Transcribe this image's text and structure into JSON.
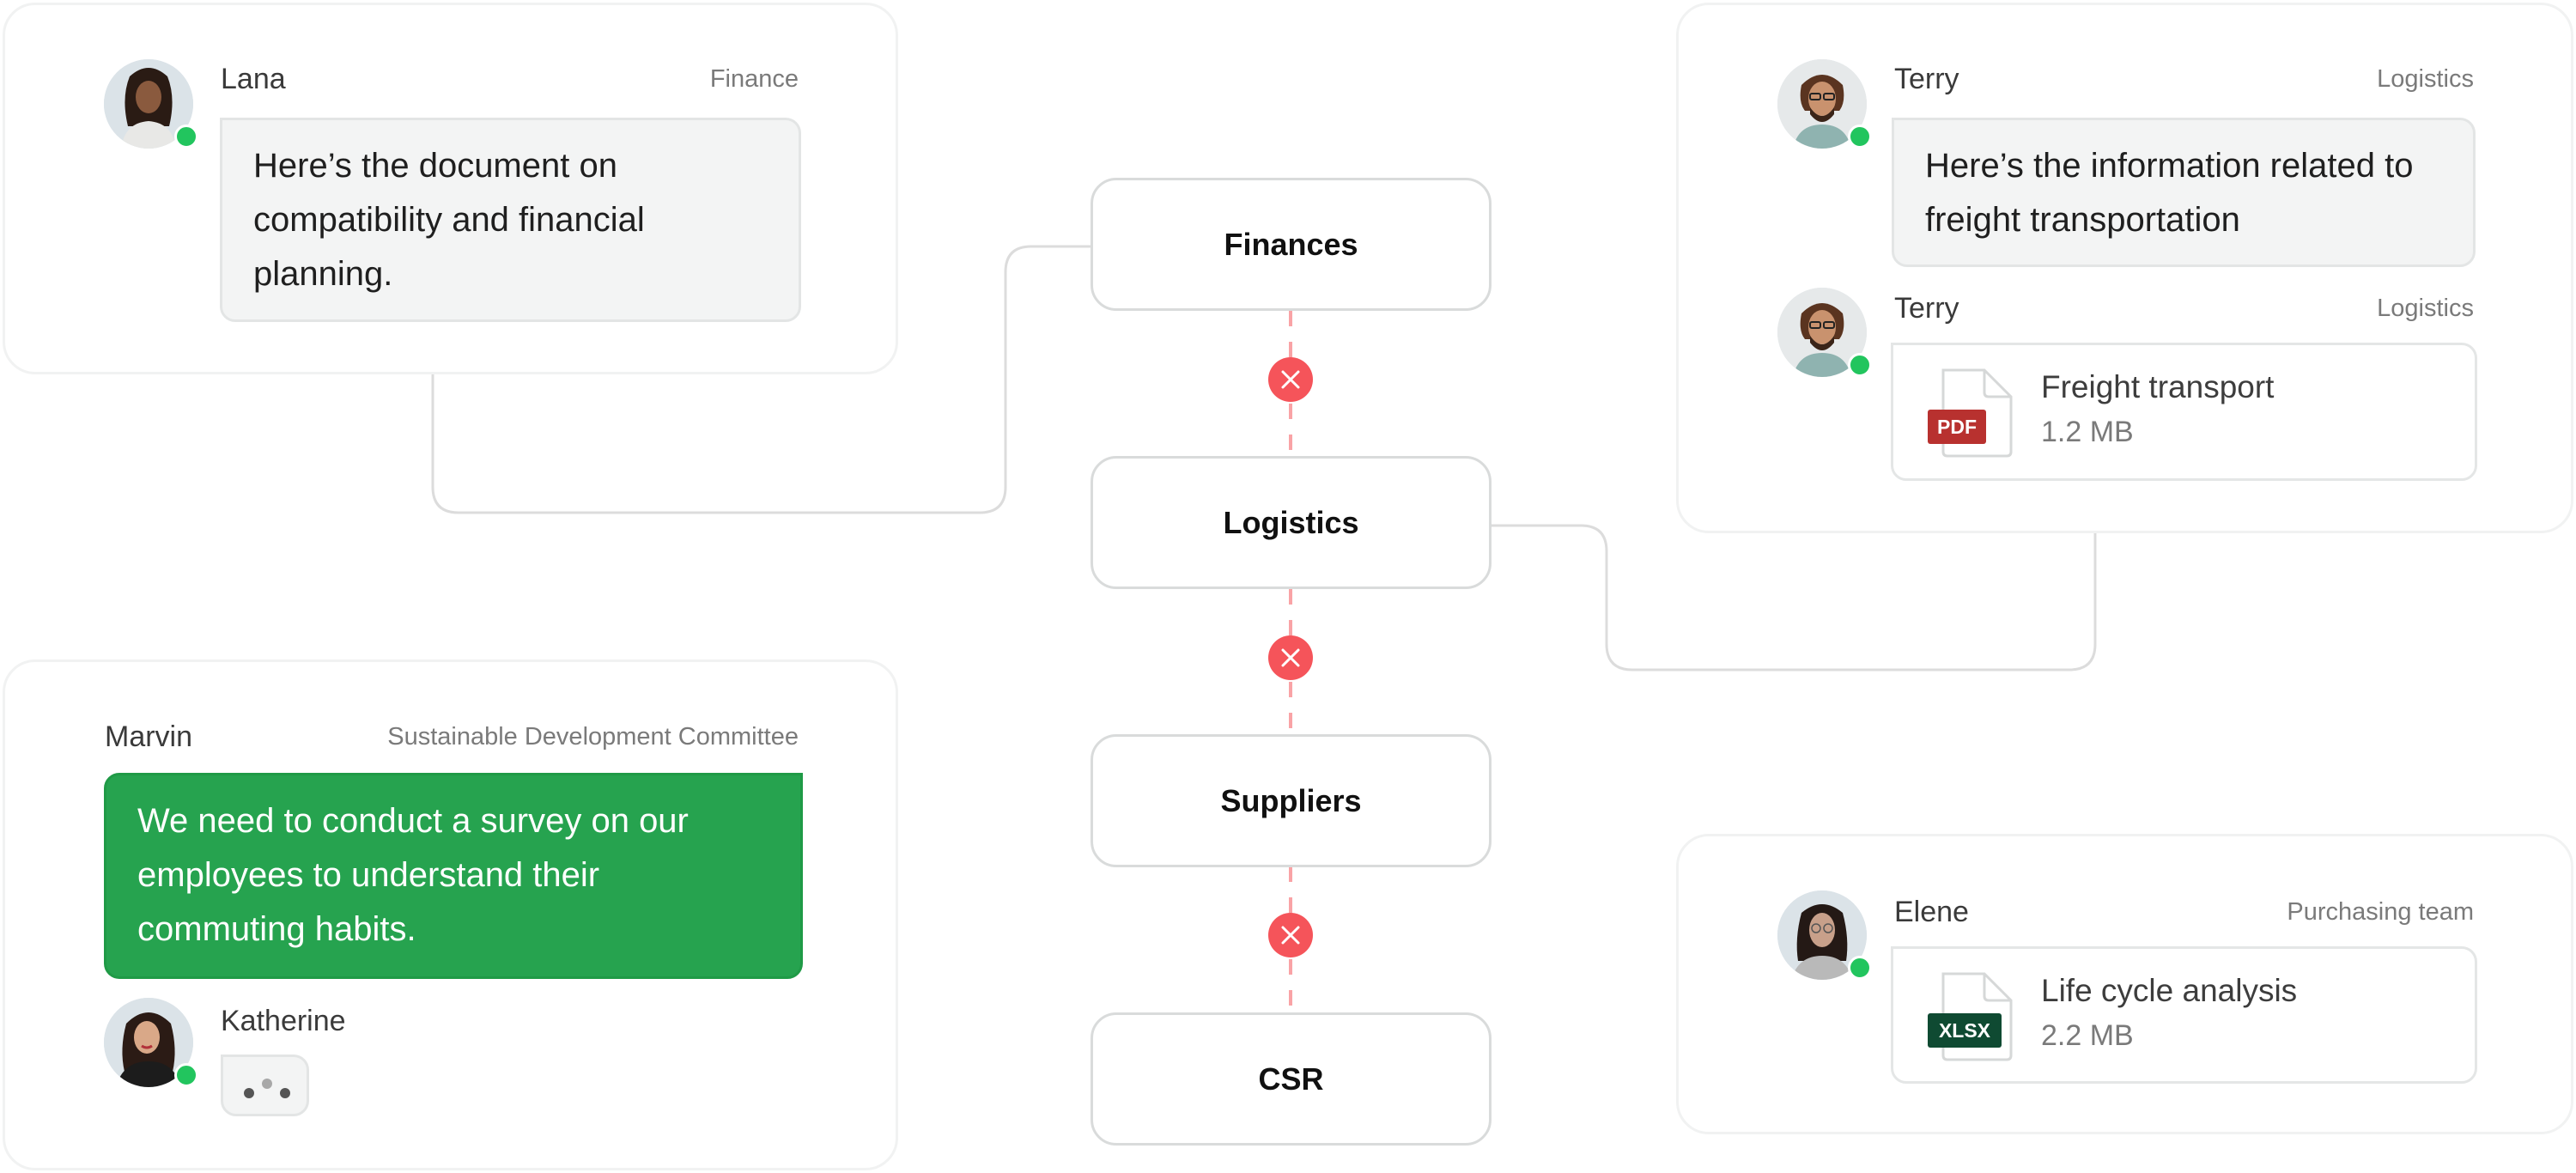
{
  "colors": {
    "accent_green": "#26a34f",
    "status_online": "#22c55e",
    "blocked_red": "#f5545a",
    "blocked_line": "#f9a3a6",
    "pdf_badge": "#b8312f",
    "xlsx_badge": "#0f4a32"
  },
  "flow": {
    "nodes": [
      {
        "label": "Finances"
      },
      {
        "label": "Logistics"
      },
      {
        "label": "Suppliers"
      },
      {
        "label": "CSR"
      }
    ],
    "links": [
      {
        "from": "Finances",
        "to": "Logistics",
        "status": "blocked",
        "icon": "x-icon"
      },
      {
        "from": "Logistics",
        "to": "Suppliers",
        "status": "blocked",
        "icon": "x-icon"
      },
      {
        "from": "Suppliers",
        "to": "CSR",
        "status": "blocked",
        "icon": "x-icon"
      }
    ]
  },
  "cards": {
    "finance": {
      "linked_node": "Finances",
      "messages": [
        {
          "sender": "Lana",
          "team": "Finance",
          "status": "online",
          "text": "Here’s the document on compatibility and financial planning."
        }
      ]
    },
    "logistics": {
      "linked_node": "Logistics",
      "messages": [
        {
          "sender": "Terry",
          "team": "Logistics",
          "status": "online",
          "text": "Here’s the information related to freight transportation"
        },
        {
          "sender": "Terry",
          "team": "Logistics",
          "status": "online",
          "file": {
            "name": "Freight transport",
            "size": "1.2 MB",
            "type": "PDF"
          }
        }
      ]
    },
    "sustainability": {
      "messages": [
        {
          "sender": "Marvin",
          "team": "Sustainable Development Committee",
          "text": "We need to conduct a survey on our employees to understand their commuting habits."
        },
        {
          "sender": "Katherine",
          "status": "online",
          "typing": true
        }
      ]
    },
    "purchasing": {
      "messages": [
        {
          "sender": "Elene",
          "team": "Purchasing team",
          "status": "online",
          "file": {
            "name": "Life cycle analysis",
            "size": "2.2 MB",
            "type": "XLSX"
          }
        }
      ]
    }
  }
}
